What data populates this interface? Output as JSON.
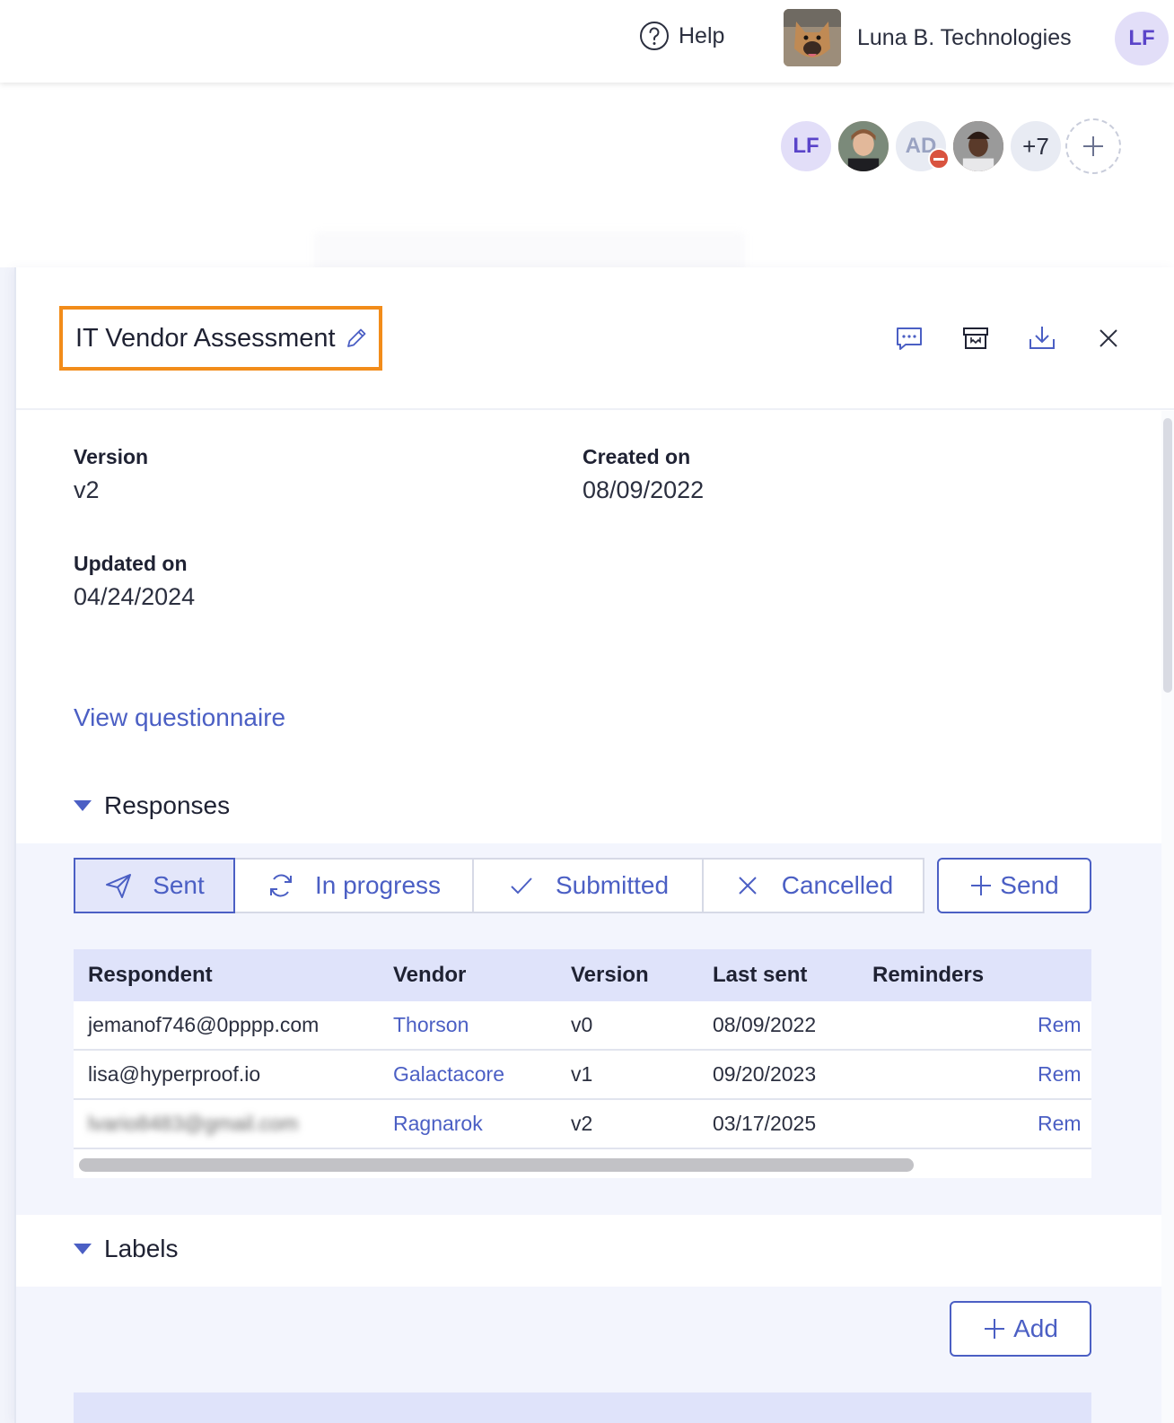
{
  "topbar": {
    "help_label": "Help",
    "org_name": "Luna B. Technologies",
    "user_initials": "LF"
  },
  "collaborators": {
    "first_initials": "LF",
    "blocked_initials": "AD",
    "more_count": "+7"
  },
  "panel": {
    "title": "IT Vendor Assessment",
    "fields": {
      "version_label": "Version",
      "version_value": "v2",
      "created_label": "Created on",
      "created_value": "08/09/2022",
      "updated_label": "Updated on",
      "updated_value": "04/24/2024"
    },
    "view_questionnaire": "View questionnaire"
  },
  "responses": {
    "heading": "Responses",
    "tabs": [
      "Sent",
      "In progress",
      "Submitted",
      "Cancelled"
    ],
    "send_label": "Send",
    "columns": [
      "Respondent",
      "Vendor",
      "Version",
      "Last sent",
      "Reminders"
    ],
    "rows": [
      {
        "respondent": "jemanof746@0pppp.com",
        "vendor": "Thorson",
        "version": "v0",
        "last_sent": "08/09/2022",
        "action": "Rem"
      },
      {
        "respondent": "lisa@hyperproof.io",
        "vendor": "Galactacore",
        "version": "v1",
        "last_sent": "09/20/2023",
        "action": "Rem"
      },
      {
        "respondent": "lvario8483@gmail.com",
        "vendor": "Ragnarok",
        "version": "v2",
        "last_sent": "03/17/2025",
        "action": "Rem"
      }
    ]
  },
  "labels": {
    "heading": "Labels",
    "add_label": "Add"
  },
  "colors": {
    "accent": "#4b5fc4",
    "highlight": "#f28c1a",
    "header_row": "#dfe3fa"
  }
}
